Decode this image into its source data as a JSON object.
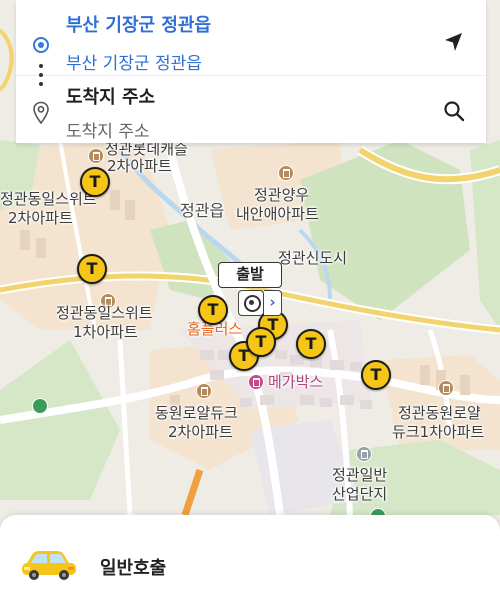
{
  "search": {
    "origin_title": "부산 기장군 정관읍",
    "origin_value": "부산 기장군 정관읍",
    "destination_title": "도착지 주소",
    "destination_placeholder": "도착지 주소"
  },
  "map": {
    "labels": {
      "apt_top_left": "정관롯데캐슬",
      "apt_top_left_2": "2차아파트",
      "apt_left_1": "정관동일스위트",
      "apt_left_1b": "2차아파트",
      "apt_yangwoo_1": "정관양우",
      "apt_yangwoo_2": "내안애아파트",
      "town": "정관읍",
      "new_city": "정관신도시",
      "apt_left_2": "정관동일스위트",
      "apt_left_2b": "1차아파트",
      "homeplus": "홈플러스",
      "megabox": "메가박스",
      "apt_dongwon_1": "동원로얄듀크",
      "apt_dongwon_1b": "2차아파트",
      "apt_dongwon_2": "정관동원로얄",
      "apt_dongwon_2b": "듀크1차아파트",
      "industrial_1": "정관일반",
      "industrial_2": "산업단지"
    },
    "start_marker_label": "출발",
    "taxi_glyph": "T"
  },
  "bottom_sheet": {
    "call_label": "일반호출"
  },
  "colors": {
    "accent_blue": "#2f6fd6",
    "taxi_yellow": "#f5c518",
    "road_yellow": "#f3d36b",
    "park_green": "#cfe3bf"
  },
  "icons": {
    "origin": "origin-target-icon",
    "destination": "location-pin-icon",
    "locate": "navigation-arrow-icon",
    "search": "search-icon",
    "car": "taxi-car-icon"
  }
}
